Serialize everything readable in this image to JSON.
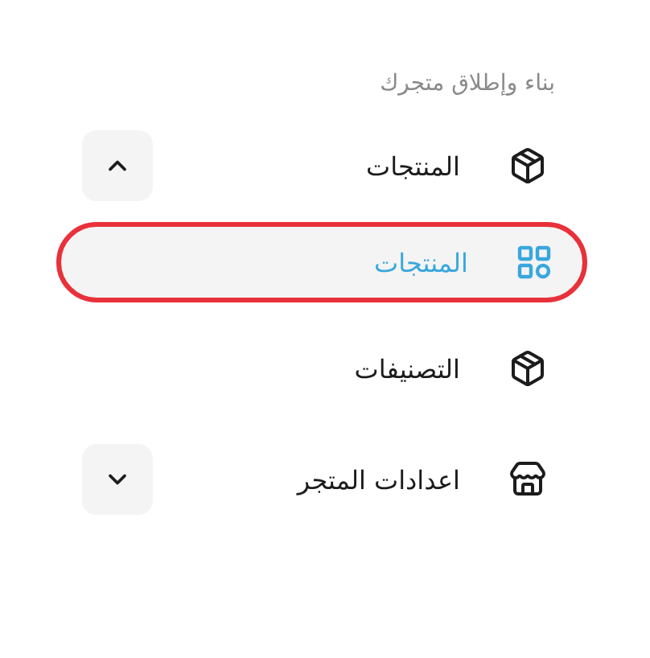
{
  "section_title": "بناء وإطلاق متجرك",
  "items": [
    {
      "kind": "group",
      "label": "المنتجات",
      "expanded": true,
      "children": [
        {
          "label": "المنتجات",
          "selected": true
        }
      ]
    },
    {
      "kind": "link",
      "label": "التصنيفات"
    },
    {
      "kind": "group",
      "label": "اعدادات المتجر",
      "expanded": false
    }
  ]
}
